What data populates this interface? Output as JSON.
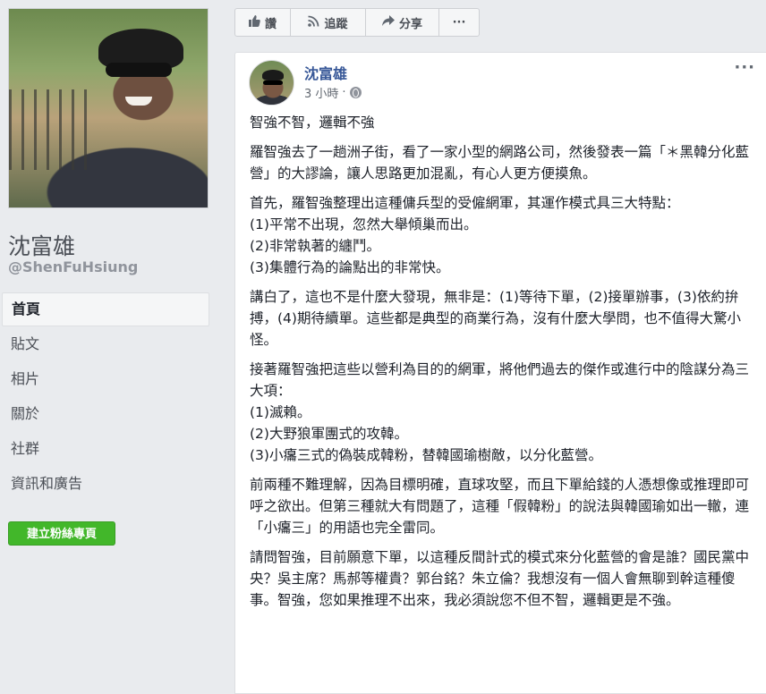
{
  "profile": {
    "name": "沈富雄",
    "handle": "@ShenFuHsiung"
  },
  "nav": {
    "items": [
      {
        "label": "首頁",
        "active": true
      },
      {
        "label": "貼文",
        "active": false
      },
      {
        "label": "相片",
        "active": false
      },
      {
        "label": "關於",
        "active": false
      },
      {
        "label": "社群",
        "active": false
      },
      {
        "label": "資訊和廣告",
        "active": false
      }
    ]
  },
  "create_page_label": "建立粉絲專頁",
  "actions": {
    "like": "讚",
    "follow": "追蹤",
    "share": "分享",
    "more": "···"
  },
  "icons": {
    "like": "thumbs-up-icon",
    "follow": "rss-icon",
    "share": "share-arrow-icon",
    "audience": "globe-icon"
  },
  "colors": {
    "author_link": "#385898",
    "create_button": "#42b72a",
    "background": "#e9ebee"
  },
  "post": {
    "author": "沈富雄",
    "time": "3 小時",
    "separator": "·",
    "more": "···",
    "paragraphs": [
      [
        "智強不智，邏輯不強"
      ],
      [
        "羅智強去了一趟洲子街，看了一家小型的網路公司，然後發表一篇「＊黑韓分化藍營」的大謬論，讓人思路更加混亂，有心人更方便摸魚。"
      ],
      [
        "首先，羅智強整理出這種傭兵型的受僱網軍，其運作模式具三大特點：",
        "(1)平常不出現，忽然大舉傾巢而出。",
        "(2)非常執著的纏鬥。",
        "(3)集體行為的論點出的非常快。"
      ],
      [
        "講白了，這也不是什麼大發現，無非是：(1)等待下單，(2)接單辦事，(3)依約拚搏，(4)期待續單。這些都是典型的商業行為，沒有什麼大學問，也不值得大驚小怪。"
      ],
      [
        "接著羅智強把這些以營利為目的的網軍，將他們過去的傑作或進行中的陰謀分為三大項：",
        "(1)滅賴。",
        "(2)大野狼軍團式的攻韓。",
        "(3)小癟三式的偽裝成韓粉，替韓國瑜樹敵，以分化藍營。"
      ],
      [
        "前兩種不難理解，因為目標明確，直球攻堅，而且下單給錢的人憑想像或推理即可呼之欲出。但第三種就大有問題了，這種「假韓粉」的說法與韓國瑜如出一轍，連「小癟三」的用語也完全雷同。"
      ],
      [
        "請問智強，目前願意下單，以這種反間計式的模式來分化藍營的會是誰？國民黨中央？吳主席？馬郝等權貴？郭台銘？朱立倫？我想沒有一個人會無聊到幹這種傻事。智強，您如果推理不出來，我必須說您不但不智，邏輯更是不強。"
      ]
    ]
  }
}
